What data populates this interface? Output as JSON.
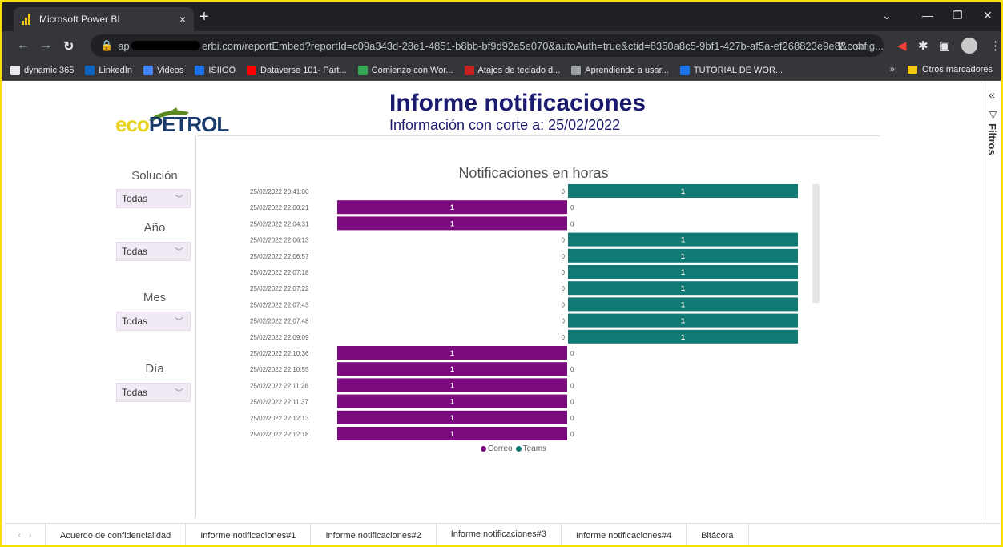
{
  "browser": {
    "tab_title": "Microsoft Power BI",
    "tab_close": "×",
    "new_tab": "+",
    "url_visible": "reportEmbed?reportId=c09a343d-28e1-4851-b8bb-bf9d92a5e070&autoAuth=true&ctid=8350a8c5-9bf1-427b-af5a-ef268823e9e8&config...",
    "url_prefix_visible": "ap",
    "url_domain_tail": "erbi.com/",
    "bookmarks": [
      {
        "label": "dynamic 365",
        "color": "#e8eaed"
      },
      {
        "label": "LinkedIn",
        "color": "#0a66c2"
      },
      {
        "label": "Videos",
        "color": "#4285f4"
      },
      {
        "label": "ISIIGO",
        "color": "#1a73e8"
      },
      {
        "label": "Dataverse 101- Part...",
        "color": "#ff0000"
      },
      {
        "label": "Comienzo con Wor...",
        "color": "#34a853"
      },
      {
        "label": "Atajos de teclado d...",
        "color": "#c5221f"
      },
      {
        "label": "Aprendiendo a usar...",
        "color": "#9aa0a6"
      },
      {
        "label": "TUTORIAL DE WOR...",
        "color": "#1a73e8"
      }
    ],
    "other_bookmarks": "Otros marcadores",
    "more_bookmarks": "»"
  },
  "report": {
    "logo": {
      "eco": "eco",
      "petrol": "PETROL"
    },
    "title": "Informe notificaciones",
    "subtitle": "Información con corte a:  25/02/2022",
    "slicers": [
      {
        "label": "Solución",
        "value": "Todas"
      },
      {
        "label": "Año",
        "value": "Todas"
      },
      {
        "label": "Mes",
        "value": "Todas"
      },
      {
        "label": "Día",
        "value": "Todas"
      }
    ],
    "filters_pane": "Filtros",
    "collapse": "«"
  },
  "chart_data": {
    "type": "bar",
    "orientation": "horizontal-diverging",
    "title": "Notificaciones en horas",
    "categories": [
      "25/02/2022 20:41:00",
      "25/02/2022 22:00:21",
      "25/02/2022 22:04:31",
      "25/02/2022 22:06:13",
      "25/02/2022 22:06:57",
      "25/02/2022 22:07:18",
      "25/02/2022 22:07:22",
      "25/02/2022 22:07:43",
      "25/02/2022 22:07:48",
      "25/02/2022 22:09:09",
      "25/02/2022 22:10:36",
      "25/02/2022 22:10:55",
      "25/02/2022 22:11:26",
      "25/02/2022 22:11:37",
      "25/02/2022 22:12:13",
      "25/02/2022 22:12:18"
    ],
    "series": [
      {
        "name": "Correo",
        "color": "#7b0a7f",
        "values": [
          0,
          1,
          1,
          0,
          0,
          0,
          0,
          0,
          0,
          0,
          1,
          1,
          1,
          1,
          1,
          1
        ]
      },
      {
        "name": "Teams",
        "color": "#117a74",
        "values": [
          1,
          0,
          0,
          1,
          1,
          1,
          1,
          1,
          1,
          1,
          0,
          0,
          0,
          0,
          0,
          0
        ]
      }
    ],
    "xlim": [
      0,
      1
    ],
    "legend_position": "bottom-center"
  },
  "page_tabs": [
    {
      "label": "Acuerdo de confidencialidad",
      "active": false
    },
    {
      "label": "Informe notificaciones#1",
      "active": false
    },
    {
      "label": "Informe notificaciones#2",
      "active": false
    },
    {
      "label": "Informe notificaciones#3",
      "active": true
    },
    {
      "label": "Informe notificaciones#4",
      "active": false
    },
    {
      "label": "Bitácora",
      "active": false
    }
  ]
}
